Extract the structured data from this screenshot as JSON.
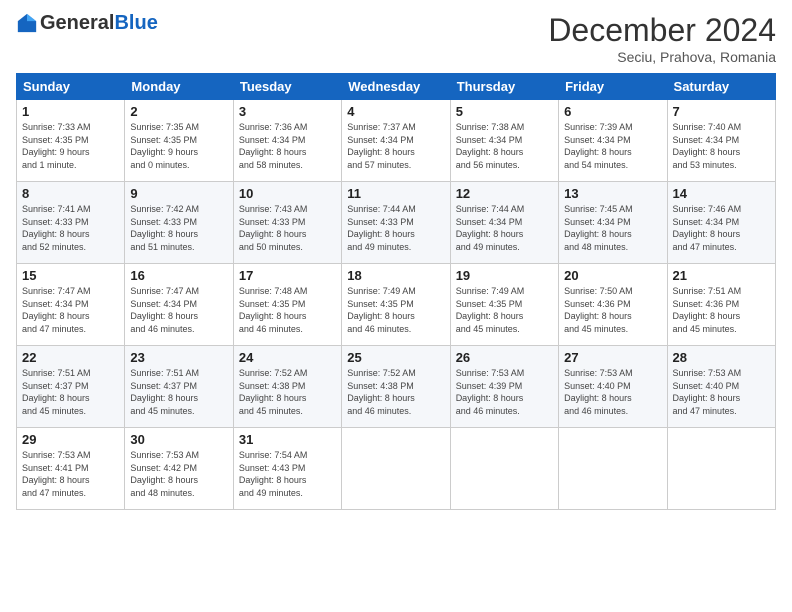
{
  "header": {
    "logo_general": "General",
    "logo_blue": "Blue",
    "month_title": "December 2024",
    "subtitle": "Seciu, Prahova, Romania"
  },
  "weekdays": [
    "Sunday",
    "Monday",
    "Tuesday",
    "Wednesday",
    "Thursday",
    "Friday",
    "Saturday"
  ],
  "weeks": [
    [
      {
        "day": "1",
        "info": "Sunrise: 7:33 AM\nSunset: 4:35 PM\nDaylight: 9 hours\nand 1 minute."
      },
      {
        "day": "2",
        "info": "Sunrise: 7:35 AM\nSunset: 4:35 PM\nDaylight: 9 hours\nand 0 minutes."
      },
      {
        "day": "3",
        "info": "Sunrise: 7:36 AM\nSunset: 4:34 PM\nDaylight: 8 hours\nand 58 minutes."
      },
      {
        "day": "4",
        "info": "Sunrise: 7:37 AM\nSunset: 4:34 PM\nDaylight: 8 hours\nand 57 minutes."
      },
      {
        "day": "5",
        "info": "Sunrise: 7:38 AM\nSunset: 4:34 PM\nDaylight: 8 hours\nand 56 minutes."
      },
      {
        "day": "6",
        "info": "Sunrise: 7:39 AM\nSunset: 4:34 PM\nDaylight: 8 hours\nand 54 minutes."
      },
      {
        "day": "7",
        "info": "Sunrise: 7:40 AM\nSunset: 4:34 PM\nDaylight: 8 hours\nand 53 minutes."
      }
    ],
    [
      {
        "day": "8",
        "info": "Sunrise: 7:41 AM\nSunset: 4:33 PM\nDaylight: 8 hours\nand 52 minutes."
      },
      {
        "day": "9",
        "info": "Sunrise: 7:42 AM\nSunset: 4:33 PM\nDaylight: 8 hours\nand 51 minutes."
      },
      {
        "day": "10",
        "info": "Sunrise: 7:43 AM\nSunset: 4:33 PM\nDaylight: 8 hours\nand 50 minutes."
      },
      {
        "day": "11",
        "info": "Sunrise: 7:44 AM\nSunset: 4:33 PM\nDaylight: 8 hours\nand 49 minutes."
      },
      {
        "day": "12",
        "info": "Sunrise: 7:44 AM\nSunset: 4:34 PM\nDaylight: 8 hours\nand 49 minutes."
      },
      {
        "day": "13",
        "info": "Sunrise: 7:45 AM\nSunset: 4:34 PM\nDaylight: 8 hours\nand 48 minutes."
      },
      {
        "day": "14",
        "info": "Sunrise: 7:46 AM\nSunset: 4:34 PM\nDaylight: 8 hours\nand 47 minutes."
      }
    ],
    [
      {
        "day": "15",
        "info": "Sunrise: 7:47 AM\nSunset: 4:34 PM\nDaylight: 8 hours\nand 47 minutes."
      },
      {
        "day": "16",
        "info": "Sunrise: 7:47 AM\nSunset: 4:34 PM\nDaylight: 8 hours\nand 46 minutes."
      },
      {
        "day": "17",
        "info": "Sunrise: 7:48 AM\nSunset: 4:35 PM\nDaylight: 8 hours\nand 46 minutes."
      },
      {
        "day": "18",
        "info": "Sunrise: 7:49 AM\nSunset: 4:35 PM\nDaylight: 8 hours\nand 46 minutes."
      },
      {
        "day": "19",
        "info": "Sunrise: 7:49 AM\nSunset: 4:35 PM\nDaylight: 8 hours\nand 45 minutes."
      },
      {
        "day": "20",
        "info": "Sunrise: 7:50 AM\nSunset: 4:36 PM\nDaylight: 8 hours\nand 45 minutes."
      },
      {
        "day": "21",
        "info": "Sunrise: 7:51 AM\nSunset: 4:36 PM\nDaylight: 8 hours\nand 45 minutes."
      }
    ],
    [
      {
        "day": "22",
        "info": "Sunrise: 7:51 AM\nSunset: 4:37 PM\nDaylight: 8 hours\nand 45 minutes."
      },
      {
        "day": "23",
        "info": "Sunrise: 7:51 AM\nSunset: 4:37 PM\nDaylight: 8 hours\nand 45 minutes."
      },
      {
        "day": "24",
        "info": "Sunrise: 7:52 AM\nSunset: 4:38 PM\nDaylight: 8 hours\nand 45 minutes."
      },
      {
        "day": "25",
        "info": "Sunrise: 7:52 AM\nSunset: 4:38 PM\nDaylight: 8 hours\nand 46 minutes."
      },
      {
        "day": "26",
        "info": "Sunrise: 7:53 AM\nSunset: 4:39 PM\nDaylight: 8 hours\nand 46 minutes."
      },
      {
        "day": "27",
        "info": "Sunrise: 7:53 AM\nSunset: 4:40 PM\nDaylight: 8 hours\nand 46 minutes."
      },
      {
        "day": "28",
        "info": "Sunrise: 7:53 AM\nSunset: 4:40 PM\nDaylight: 8 hours\nand 47 minutes."
      }
    ],
    [
      {
        "day": "29",
        "info": "Sunrise: 7:53 AM\nSunset: 4:41 PM\nDaylight: 8 hours\nand 47 minutes."
      },
      {
        "day": "30",
        "info": "Sunrise: 7:53 AM\nSunset: 4:42 PM\nDaylight: 8 hours\nand 48 minutes."
      },
      {
        "day": "31",
        "info": "Sunrise: 7:54 AM\nSunset: 4:43 PM\nDaylight: 8 hours\nand 49 minutes."
      },
      null,
      null,
      null,
      null
    ]
  ]
}
